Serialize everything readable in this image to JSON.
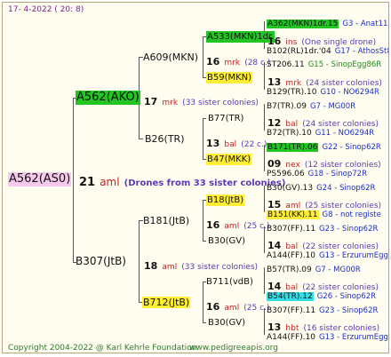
{
  "colors": {
    "green_hi": "#22c522",
    "yellow_hi": "#ffee33",
    "cyan_hi": "#33dde6",
    "pink_hi": "#f6c8ee",
    "mark_red": "#c41e1e",
    "desc_purple": "#5c3ab4",
    "place_blue": "#1b2fc8",
    "place_green": "#1f8a1f"
  },
  "header": {
    "date": "17-  4-2022 (  20:   8)"
  },
  "footer": {
    "copyright": "Copyright 2004-2022 @ Karl Kehrle Foundation",
    "site": "www.pedigreeapis.org"
  },
  "root": {
    "label": "A562(AS0)",
    "num": "21",
    "mark": "aml",
    "desc": "(Drones from 33 sister colonies)"
  },
  "gen1": {
    "mother": {
      "label": "A562(AKO)",
      "num": "17",
      "mark": "mrk",
      "desc": "(33 sister colonies)"
    },
    "father": {
      "label": "B307(JtB)",
      "num": "18",
      "mark": "aml",
      "desc": "(33 sister colonies)"
    }
  },
  "gen2": {
    "a609": {
      "label": "A609(MKN)",
      "num": "16",
      "mark": "mrk",
      "desc": "(28 c.)"
    },
    "b26": {
      "label": "B26(TR)",
      "num": "13",
      "mark": "bal",
      "desc": "(22 c.)"
    },
    "b181": {
      "label": "B181(JtB)",
      "num": "16",
      "mark": "aml",
      "desc": "(25 c.)"
    },
    "b712": {
      "label": "B712(JtB)",
      "num": "16",
      "mark": "aml",
      "desc": "(25 c.)"
    }
  },
  "gen3": {
    "a533": {
      "label": "A533(MKN)1dr.",
      "num": "16",
      "mark": "ins",
      "desc": "(One single drone)"
    },
    "b59": {
      "label": "B59(MKN)",
      "num": "13",
      "mark": "mrk",
      "desc": "(24 sister colonies)"
    },
    "b77": {
      "label": "B77(TR)",
      "num": "12",
      "mark": "bal",
      "desc": "(24 sister colonies)"
    },
    "b47": {
      "label": "B47(MKK)",
      "num": "09",
      "mark": "nex",
      "desc": "(12 sister colonies)"
    },
    "b18": {
      "label": "B18(JtB)",
      "num": "15",
      "mark": "aml",
      "desc": "(25 sister colonies)"
    },
    "b30a": {
      "label": "B30(GV)",
      "num": "14",
      "mark": "bal",
      "desc": "(22 sister colonies)"
    },
    "b711": {
      "label": "B711(vdB)",
      "num": "14",
      "mark": "bal",
      "desc": "(22 sister colonies)"
    },
    "b30b": {
      "label": "B30(GV)",
      "num": "13",
      "mark": "hbt",
      "desc": "(16 sister colonies)"
    }
  },
  "gen4": [
    {
      "label": "A362(MKN)1dr.15",
      "place": "G3 - Anat11Q"
    },
    {
      "label": "B102(RL)1dr.'04",
      "place": "G17 - AthosSt80R"
    },
    {
      "label": "ST206.11",
      "place": "G15 - SinopEgg86R"
    },
    {
      "label": "B129(TR).10",
      "place": "G10 - NO6294R"
    },
    {
      "label": "B7(TR).09",
      "place": "G7 - MG00R"
    },
    {
      "label": "B72(TR).10",
      "place": "G11 - NO6294R"
    },
    {
      "label": "B171(TR).06",
      "place": "G22 - Sinop62R"
    },
    {
      "label": "PS596.06",
      "place": "G18 - Sinop72R"
    },
    {
      "label": "B30(GV).13",
      "place": "G24 - Sinop62R"
    },
    {
      "label": "B151(KK).11",
      "place": "G8 - not registe"
    },
    {
      "label": "B307(FF).11",
      "place": "G23 - Sinop62R"
    },
    {
      "label": "A144(FF).10",
      "place": "G13 - ErzurumEgg8"
    },
    {
      "label": "B57(TR).09",
      "place": "G7 - MG00R"
    },
    {
      "label": "B54(TR).12",
      "place": "G26 - Sinop62R"
    },
    {
      "label": "B307(FF).11",
      "place": "G23 - Sinop62R"
    },
    {
      "label": "A144(FF).10",
      "place": "G13 - ErzurumEgg8"
    }
  ]
}
